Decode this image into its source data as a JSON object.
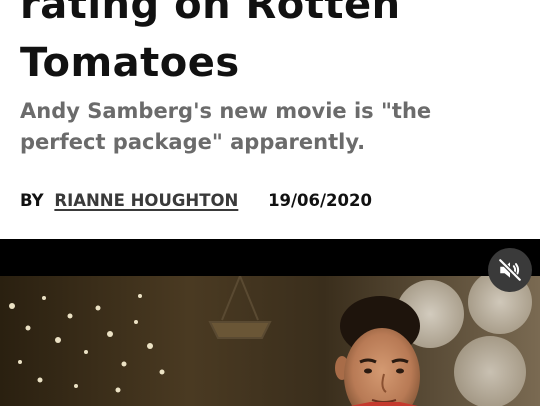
{
  "article": {
    "headline_line1": "rating on Rotten",
    "headline_line2": "Tomatoes",
    "subheading_line1": "Andy Samberg's new movie is \"the",
    "subheading_line2": "perfect package\" apparently.",
    "byline_prefix": "BY",
    "author": "RIANNE HOUGHTON",
    "date": "19/06/2020"
  },
  "video": {
    "mute_icon": "speaker-muted-icon",
    "muted": true
  },
  "colors": {
    "headline": "#111111",
    "subheading": "#6b6b6b",
    "video_background": "#000000",
    "mute_button": "#3a3a3a"
  }
}
